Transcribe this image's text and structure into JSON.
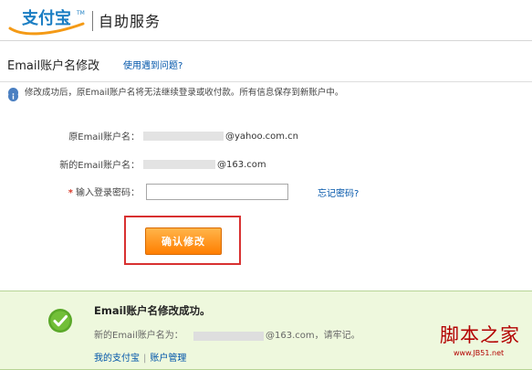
{
  "app": {
    "logo_text": "支付宝",
    "logo_colors": {
      "primary": "#1b7ec3",
      "secondary": "#f49a16"
    },
    "header_title": "自助服务"
  },
  "section": {
    "title": "Email账户名修改",
    "help_link": "使用遇到问题?"
  },
  "notice": {
    "icon": "info-icon",
    "text": "修改成功后，原Email账户名将无法继续登录或收付款。所有信息保存到新账户中。"
  },
  "form": {
    "old_account_label": "原Email账户名：",
    "old_account_value": "@yahoo.com.cn",
    "new_account_label": "新的Email账户名：",
    "new_account_value": "@163.com",
    "required_mark": "*",
    "password_label": "输入登录密码：",
    "password_value": "",
    "password_placeholder": "",
    "forgot_password_link": "忘记密码?",
    "confirm_button": "确认修改"
  },
  "colors": {
    "highlight_box": "#d83131",
    "confirm_button": "#ff8f14",
    "success_background": "#eef8dd",
    "link": "#0055aa",
    "watermark": "#b30000"
  },
  "success": {
    "icon": "checkmark-icon",
    "title": "Email账户名修改成功。",
    "new_account_prefix": "新的Email账户名为：",
    "new_account_value": "@163.com，请牢记。",
    "my_alipay_link": "我的支付宝",
    "separator": "|",
    "account_management_link": "账户管理"
  },
  "watermark": {
    "title": "脚本之家",
    "domain": "www.JB51.net"
  }
}
